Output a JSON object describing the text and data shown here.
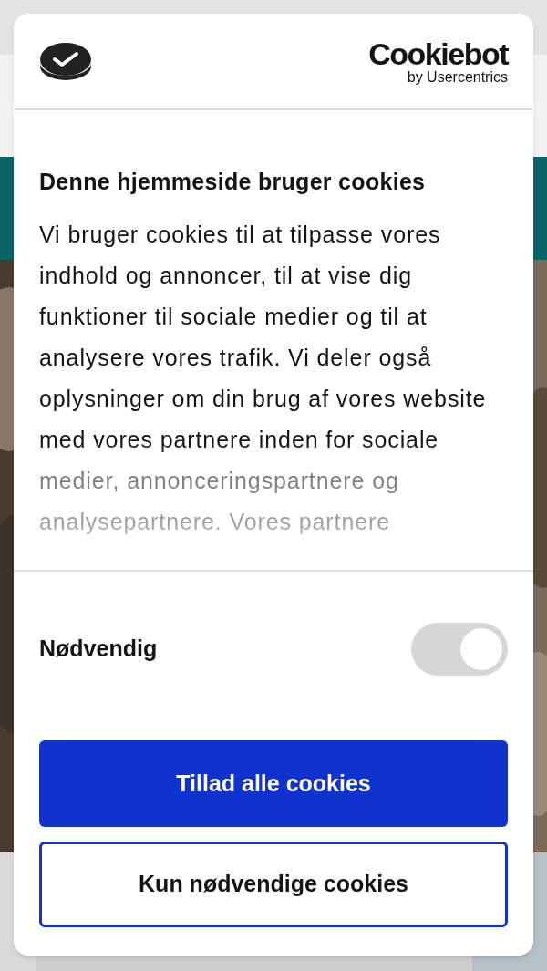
{
  "dialog": {
    "brand": {
      "name": "Cookiebot",
      "byline": "by Usercentrics"
    },
    "title": "Denne hjemmeside bruger cookies",
    "body": "Vi bruger cookies til at tilpasse vores indhold og annoncer, til at vise dig funktioner til sociale medier og til at analysere vores trafik. Vi deler også oplysninger om din brug af vores website med vores partnere inden for sociale medier, annonceringspartnere og analysepartnere. Vores partnere",
    "toggles": [
      {
        "label": "Nødvendig",
        "checked": true,
        "disabled": true
      }
    ],
    "buttons": [
      {
        "label": "Tillad alle cookies",
        "kind": "primary"
      },
      {
        "label": "Kun nødvendige cookies",
        "kind": "outline"
      }
    ]
  }
}
